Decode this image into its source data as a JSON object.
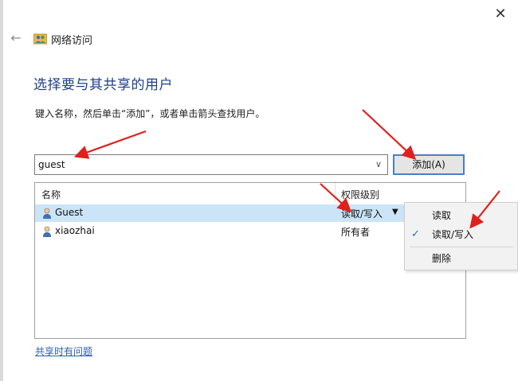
{
  "window": {
    "title": "网络访问",
    "close_glyph": "✕",
    "back_glyph": "←"
  },
  "heading": "选择要与其共享的用户",
  "instruction": "键入名称，然后单击“添加”，或者单击箭头查找用户。",
  "user_input": {
    "value": "guest",
    "placeholder": ""
  },
  "add_button": {
    "label": "添加(A)"
  },
  "table": {
    "columns": [
      "名称",
      "权限级别"
    ],
    "rows": [
      {
        "name": "Guest",
        "permission": "读取/写入",
        "selected": true
      },
      {
        "name": "xiaozhai",
        "permission": "所有者",
        "selected": false
      }
    ]
  },
  "permission_menu": {
    "items": [
      {
        "label": "读取",
        "checked": false
      },
      {
        "label": "读取/写入",
        "checked": true
      },
      {
        "label": "删除",
        "checked": false
      }
    ]
  },
  "help_link": "共享时有问题",
  "colors": {
    "heading": "#1e3f8a",
    "selection": "#cce4f7",
    "annotation_arrow": "#e0201c",
    "link": "#2a5db0"
  }
}
